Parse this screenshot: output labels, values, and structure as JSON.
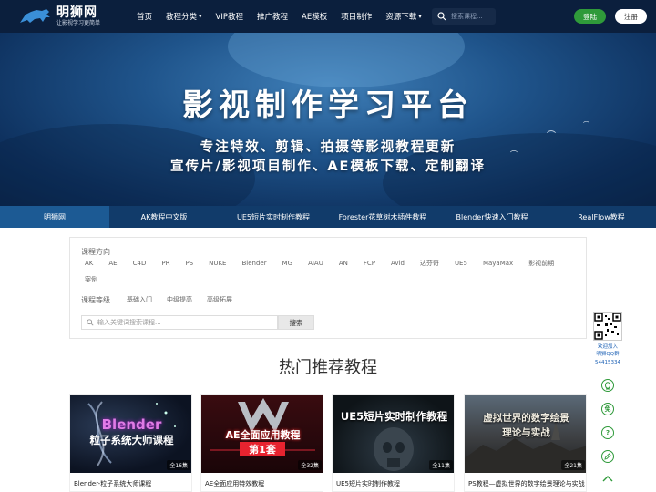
{
  "header": {
    "logo_title": "明狮网",
    "logo_subtitle": "让影视学习更简单",
    "nav": [
      {
        "label": "首页",
        "dropdown": false
      },
      {
        "label": "教程分类",
        "dropdown": true
      },
      {
        "label": "VIP教程",
        "dropdown": false
      },
      {
        "label": "推广教程",
        "dropdown": false
      },
      {
        "label": "AE模板",
        "dropdown": false
      },
      {
        "label": "项目制作",
        "dropdown": false
      },
      {
        "label": "资源下载",
        "dropdown": true
      }
    ],
    "search_placeholder": "搜索课程...",
    "login_label": "登陆",
    "register_label": "注册"
  },
  "banner": {
    "title": "影视制作学习平台",
    "subtitle_line1": "专注特效、剪辑、拍摄等影视教程更新",
    "subtitle_line2": "宣传片/影视项目制作、AE模板下载、定制翻译"
  },
  "category_bar": [
    "明狮网",
    "AK教程中文版",
    "UE5短片实时制作教程",
    "Forester花草树木插件教程",
    "Blender快速入门教程",
    "RealFlow教程"
  ],
  "filter": {
    "direction_label": "课程方向",
    "direction_tags": [
      "AK",
      "AE",
      "C4D",
      "PR",
      "PS",
      "NUKE",
      "Blender",
      "MG",
      "AIAU",
      "AN",
      "FCP",
      "Avid",
      "达芬奇",
      "UE5",
      "MayaMax",
      "影视前期",
      "案例"
    ],
    "level_label": "课程等级",
    "level_tags": [
      "基础入门",
      "中级提高",
      "高级拓展"
    ],
    "search_placeholder": "输入关键词搜索课程...",
    "search_button": "搜索"
  },
  "section_title": "热门推荐教程",
  "cards": [
    {
      "image_text_line1": "Blender",
      "image_text_line2": "粒子系统大师课程",
      "episodes": "全16集",
      "title": "Blender-粒子系统大师课程"
    },
    {
      "image_text_line1": "AE全面应用教程",
      "image_text_line2": "第1套",
      "episodes": "全32集",
      "title": "AE全面应用特效教程"
    },
    {
      "image_text_line1": "UE5短片实时制作教程",
      "episodes": "全11集",
      "title": "UE5短片实时制作教程"
    },
    {
      "image_text_line1": "虚拟世界的数字绘景",
      "image_text_line2": "理论与实战",
      "episodes": "全21集",
      "title": "PS教程—虚拟世界的数字绘景理论与实战"
    }
  ],
  "side": {
    "qr_line1": "欢迎加入",
    "qr_line2": "明狮QQ群",
    "qr_line3": "54415334",
    "icons": [
      "qq-icon",
      "free-icon",
      "help-icon",
      "edit-icon",
      "back-to-top-icon"
    ],
    "free_glyph": "免",
    "help_glyph": "?"
  },
  "colors": {
    "header_bg": "#0b1f3d",
    "category_bar_bg": "#113b6a",
    "login_green": "#2f9a3a"
  }
}
